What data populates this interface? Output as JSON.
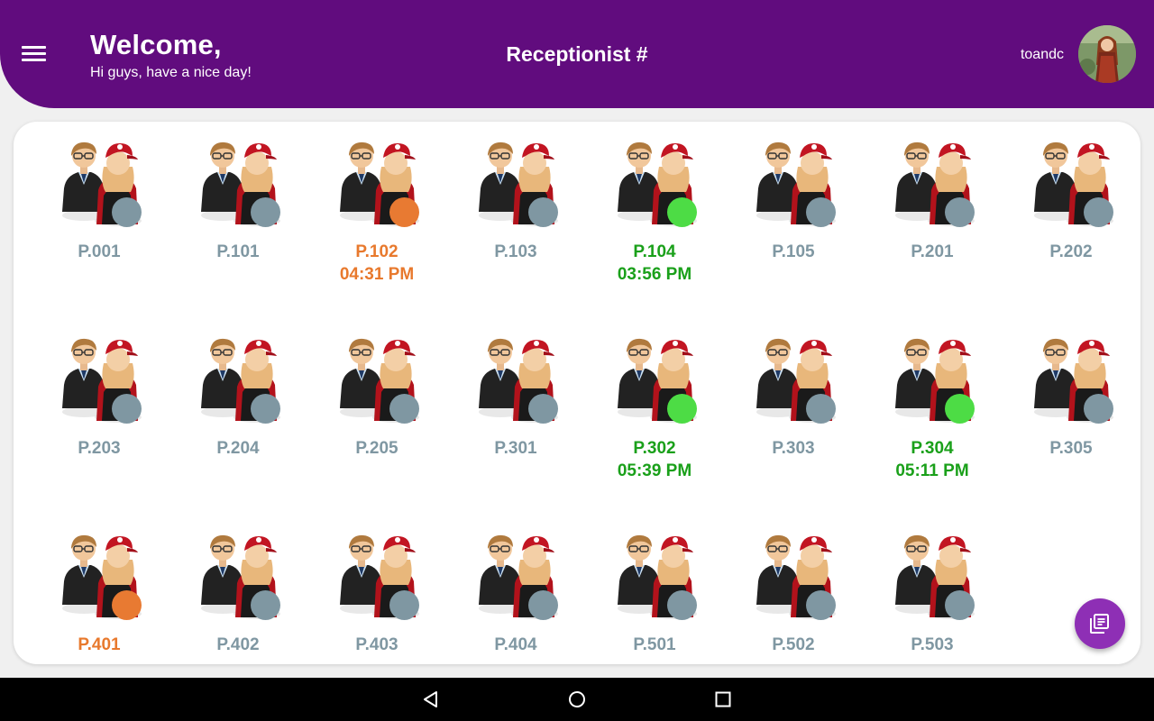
{
  "header": {
    "welcome_title": "Welcome,",
    "welcome_subtitle": "Hi guys, have a nice day!",
    "page_title": "Receptionist #",
    "username": "toandc"
  },
  "colors": {
    "header_bg": "#610c7e",
    "status_idle": "#7f97a2",
    "status_busy": "#e87a32",
    "status_active": "#4ddc45",
    "label_idle": "#7f97a2",
    "label_busy": "#e8792d",
    "label_active": "#1aa01a",
    "fab": "#8e2fb5"
  },
  "status_legend": {
    "idle": "gray",
    "busy": "orange",
    "active": "green"
  },
  "rooms": [
    {
      "name": "P.001",
      "status": "idle",
      "time": ""
    },
    {
      "name": "P.101",
      "status": "idle",
      "time": ""
    },
    {
      "name": "P.102",
      "status": "busy",
      "time": "04:31 PM"
    },
    {
      "name": "P.103",
      "status": "idle",
      "time": ""
    },
    {
      "name": "P.104",
      "status": "active",
      "time": "03:56 PM"
    },
    {
      "name": "P.105",
      "status": "idle",
      "time": ""
    },
    {
      "name": "P.201",
      "status": "idle",
      "time": ""
    },
    {
      "name": "P.202",
      "status": "idle",
      "time": ""
    },
    {
      "name": "P.203",
      "status": "idle",
      "time": ""
    },
    {
      "name": "P.204",
      "status": "idle",
      "time": ""
    },
    {
      "name": "P.205",
      "status": "idle",
      "time": ""
    },
    {
      "name": "P.301",
      "status": "idle",
      "time": ""
    },
    {
      "name": "P.302",
      "status": "active",
      "time": "05:39 PM"
    },
    {
      "name": "P.303",
      "status": "idle",
      "time": ""
    },
    {
      "name": "P.304",
      "status": "active",
      "time": "05:11 PM"
    },
    {
      "name": "P.305",
      "status": "idle",
      "time": ""
    },
    {
      "name": "P.401",
      "status": "busy",
      "time": ""
    },
    {
      "name": "P.402",
      "status": "idle",
      "time": ""
    },
    {
      "name": "P.403",
      "status": "idle",
      "time": ""
    },
    {
      "name": "P.404",
      "status": "idle",
      "time": ""
    },
    {
      "name": "P.501",
      "status": "idle",
      "time": ""
    },
    {
      "name": "P.502",
      "status": "idle",
      "time": ""
    },
    {
      "name": "P.503",
      "status": "idle",
      "time": ""
    }
  ],
  "icons": {
    "menu": "hamburger-icon",
    "room": "users-couple-icon",
    "fab": "library-books-icon",
    "nav_back": "triangle-back-icon",
    "nav_home": "circle-home-icon",
    "nav_recents": "square-recents-icon"
  }
}
